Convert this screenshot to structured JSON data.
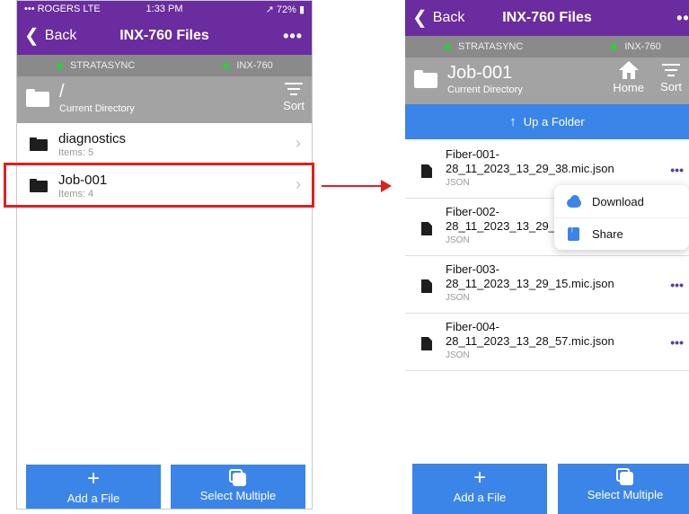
{
  "status": {
    "carrier": "••• ROGERS  LTE",
    "time": "1:33 PM",
    "battery": "↗ 72% ▮"
  },
  "nav": {
    "back_label": "Back",
    "title": "INX-760 Files",
    "more": "•••"
  },
  "devices": {
    "cloud": "STRATASYNC",
    "instrument": "INX-760",
    "connected_color": "#2ecc40"
  },
  "left": {
    "dir": {
      "name": "/",
      "subtitle": "Current Directory",
      "sort_label": "Sort"
    },
    "folders": [
      {
        "name": "diagnostics",
        "items": "Items: 5",
        "chevron": "›"
      },
      {
        "name": "Job-001",
        "items": "Items: 4",
        "chevron": "›"
      }
    ]
  },
  "right": {
    "dir": {
      "name": "Job-001",
      "subtitle": "Current Directory",
      "home_label": "Home",
      "sort_label": "Sort"
    },
    "up_folder": {
      "arrow": "↑",
      "label": "Up a Folder"
    },
    "files": [
      {
        "line1": "Fiber-001-",
        "line2": "28_11_2023_13_29_38.mic.json",
        "type": "JSON",
        "more": "•••"
      },
      {
        "line1": "Fiber-002-",
        "line2": "28_11_2023_13_29_",
        "type": "JSON",
        "more": ""
      },
      {
        "line1": "Fiber-003-",
        "line2": "28_11_2023_13_29_15.mic.json",
        "type": "JSON",
        "more": "•••"
      },
      {
        "line1": "Fiber-004-",
        "line2": "28_11_2023_13_28_57.mic.json",
        "type": "JSON",
        "more": "•••"
      }
    ],
    "menu": {
      "download": "Download",
      "share": "Share"
    }
  },
  "bottom": {
    "add_icon": "+",
    "add_label": "Add a File",
    "select_label": "Select Multiple"
  },
  "colors": {
    "header": "#6a2c9e",
    "device_bar": "#8a8a8a",
    "dir_header": "#a3a3a3",
    "action_blue": "#3b85e8",
    "highlight": "#e02020"
  }
}
